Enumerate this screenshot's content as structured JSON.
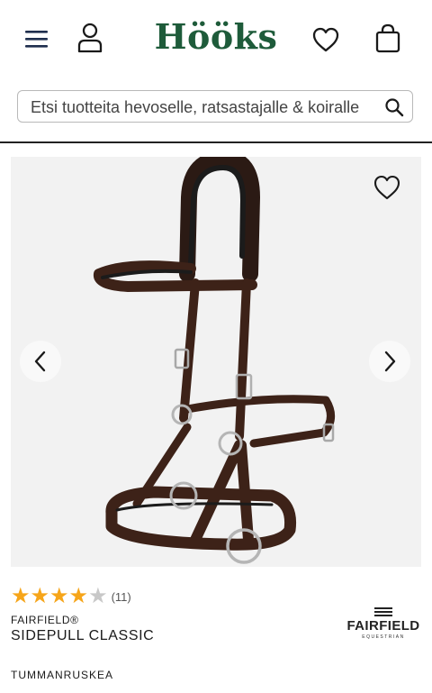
{
  "header": {
    "logo": "Hööks",
    "icons": [
      "menu-icon",
      "user-icon",
      "heart-icon",
      "shopping-bag-icon"
    ]
  },
  "search": {
    "placeholder": "Etsi tuotteita hevoselle, ratsastajalle & koiralle"
  },
  "product": {
    "rating": {
      "stars": 4,
      "max": 5,
      "count_label": "(11)"
    },
    "brand": "FAIRFIELD®",
    "name": "SIDEPULL CLASSIC",
    "color": "TUMMANRUSKEA",
    "brand_logo": {
      "name": "FAIRFIELD",
      "sub": "EQUESTRIAN"
    }
  },
  "colors": {
    "brand_green": "#1e5b3a",
    "star_filled": "#f6a51a",
    "star_empty": "#c8c8c8",
    "leather": "#3d2218",
    "gallery_bg": "#f2f2f2"
  }
}
